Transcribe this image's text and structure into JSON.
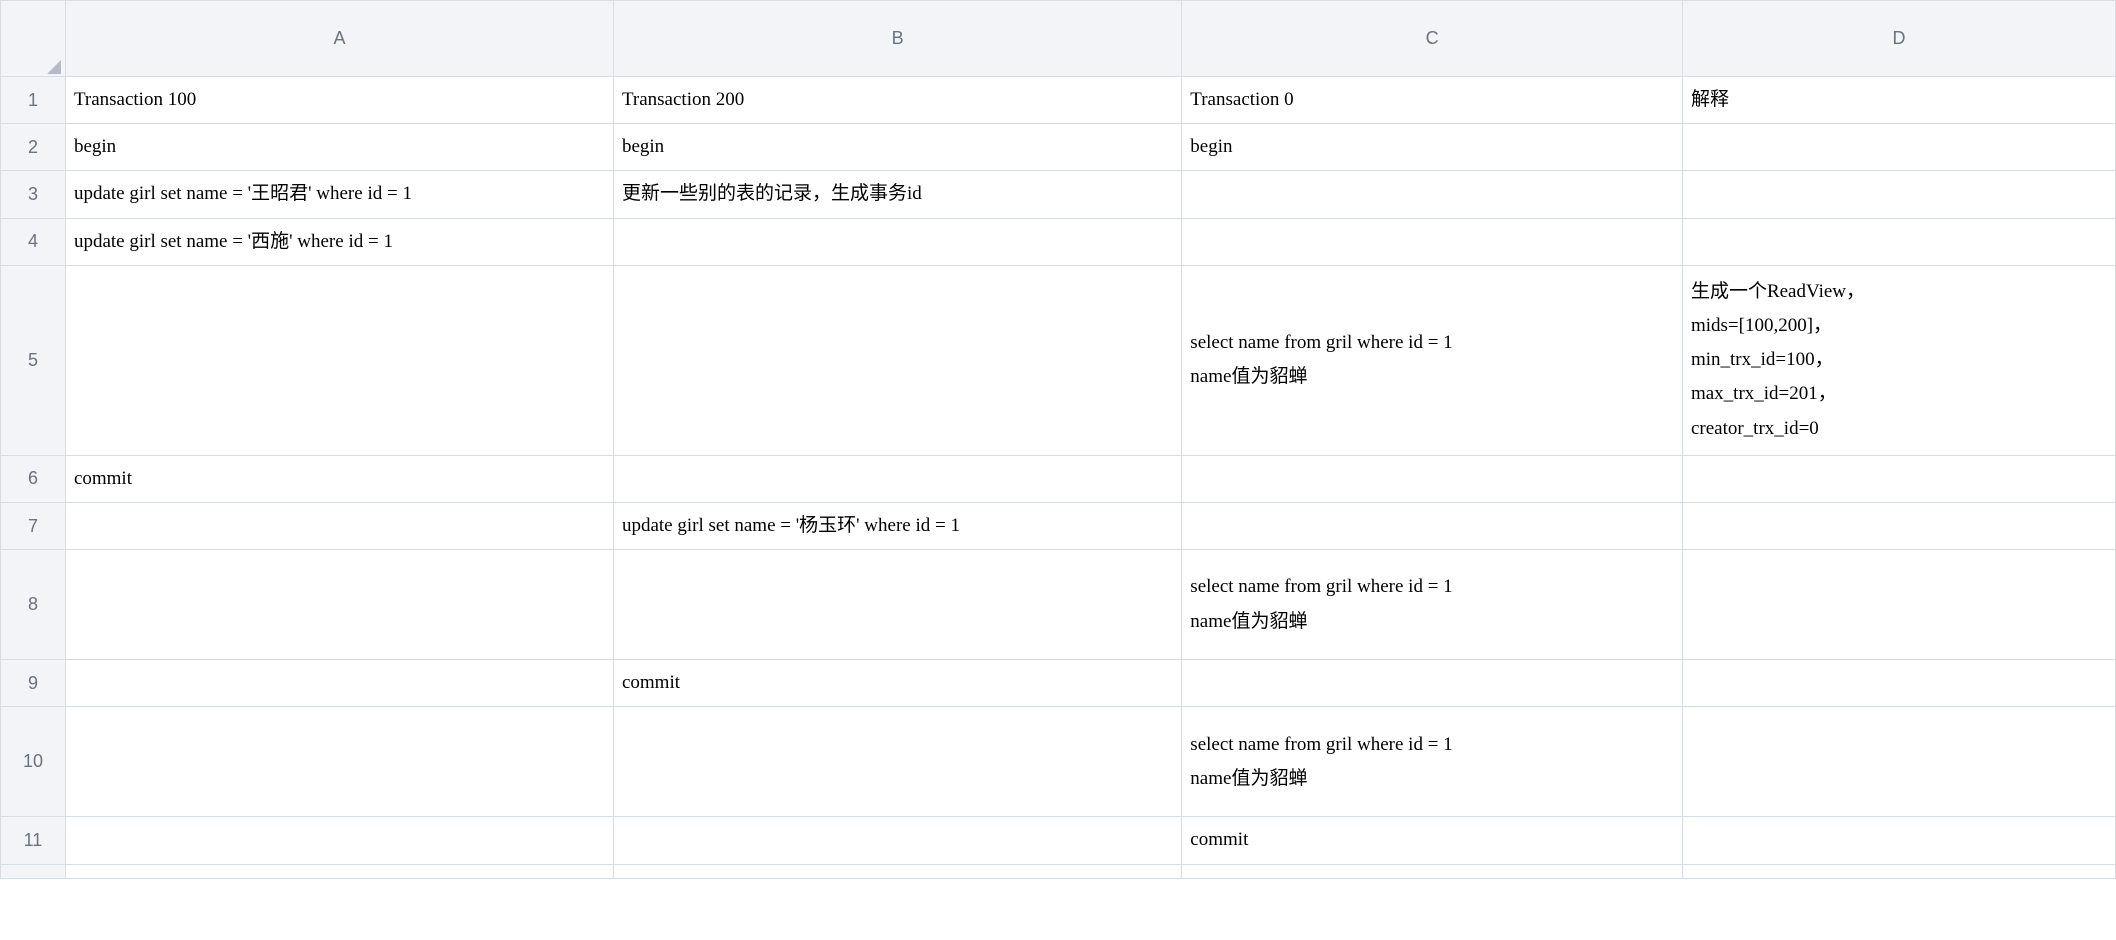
{
  "columns": {
    "A": "A",
    "B": "B",
    "C": "C",
    "D": "D"
  },
  "rownums": {
    "r1": "1",
    "r2": "2",
    "r3": "3",
    "r4": "4",
    "r5": "5",
    "r6": "6",
    "r7": "7",
    "r8": "8",
    "r9": "9",
    "r10": "10",
    "r11": "11",
    "r12": ""
  },
  "cells": {
    "r1": {
      "A": "Transaction 100",
      "B": "Transaction 200",
      "C": "Transaction 0",
      "D": "解释"
    },
    "r2": {
      "A": "begin",
      "B": "begin",
      "C": "begin",
      "D": ""
    },
    "r3": {
      "A": "update girl set name = '王昭君' where id = 1",
      "B": "更新一些别的表的记录，生成事务id",
      "C": "",
      "D": ""
    },
    "r4": {
      "A": "update girl set name = '西施' where id = 1",
      "B": "",
      "C": "",
      "D": ""
    },
    "r5": {
      "A": "",
      "B": "",
      "C": "select name from gril where id = 1\nname值为貂蝉",
      "D": "生成一个ReadView，\nmids=[100,200]，\nmin_trx_id=100，\nmax_trx_id=201，\ncreator_trx_id=0"
    },
    "r6": {
      "A": "commit",
      "B": "",
      "C": "",
      "D": ""
    },
    "r7": {
      "A": "",
      "B": "update girl set name = '杨玉环' where id = 1",
      "C": "",
      "D": ""
    },
    "r8": {
      "A": "",
      "B": "",
      "C": "select name from gril where id = 1\nname值为貂蝉",
      "D": ""
    },
    "r9": {
      "A": "",
      "B": "commit",
      "C": "",
      "D": ""
    },
    "r10": {
      "A": "",
      "B": "",
      "C": "select name from gril where id = 1\nname值为貂蝉",
      "D": ""
    },
    "r11": {
      "A": "",
      "B": "",
      "C": "commit",
      "D": ""
    },
    "r12": {
      "A": "",
      "B": "",
      "C": "",
      "D": ""
    }
  },
  "chart_data": {
    "type": "table",
    "columns": [
      "Transaction 100",
      "Transaction 200",
      "Transaction 0",
      "解释"
    ],
    "rows": [
      [
        "begin",
        "begin",
        "begin",
        ""
      ],
      [
        "update girl set name = '王昭君' where id = 1",
        "更新一些别的表的记录，生成事务id",
        "",
        ""
      ],
      [
        "update girl set name = '西施' where id = 1",
        "",
        "",
        ""
      ],
      [
        "",
        "",
        "select name from gril where id = 1 name值为貂蝉",
        "生成一个ReadView，mids=[100,200]，min_trx_id=100，max_trx_id=201，creator_trx_id=0"
      ],
      [
        "commit",
        "",
        "",
        ""
      ],
      [
        "",
        "update girl set name = '杨玉环' where id = 1",
        "",
        ""
      ],
      [
        "",
        "",
        "select name from gril where id = 1 name值为貂蝉",
        ""
      ],
      [
        "",
        "commit",
        "",
        ""
      ],
      [
        "",
        "",
        "select name from gril where id = 1 name值为貂蝉",
        ""
      ],
      [
        "",
        "",
        "commit",
        ""
      ]
    ]
  }
}
